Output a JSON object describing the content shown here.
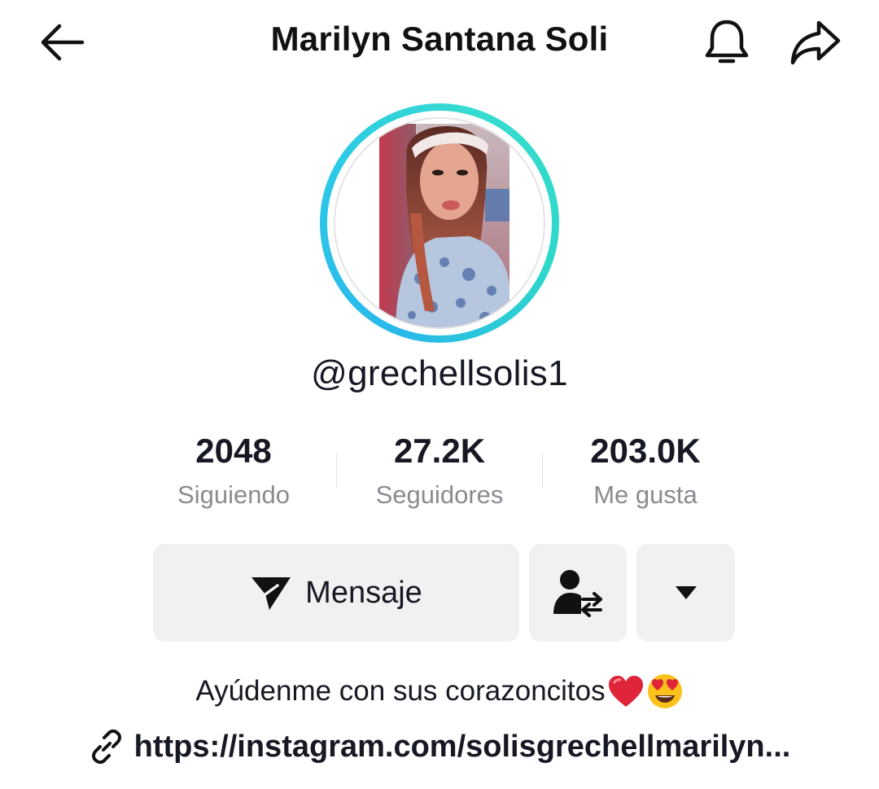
{
  "header": {
    "title": "Marilyn Santana Soli",
    "back_icon": "arrow-left-icon",
    "bell_icon": "bell-icon",
    "share_icon": "share-arrow-icon"
  },
  "profile": {
    "avatar": "profile-photo",
    "ring_colors": [
      "#28b8ea",
      "#36dccf"
    ],
    "username": "@grechellsolis1"
  },
  "stats": [
    {
      "value": "2048",
      "label": "Siguiendo"
    },
    {
      "value": "27.2K",
      "label": "Seguidores"
    },
    {
      "value": "203.0K",
      "label": "Me gusta"
    }
  ],
  "actions": {
    "message_label": "Mensaje",
    "message_icon": "send-icon",
    "follow_icon": "user-swap-icon",
    "more_icon": "caret-down-icon"
  },
  "bio": {
    "text": "Ayúdenme con sus corazoncitos",
    "emojis": [
      "red-heart-icon",
      "heart-eyes-icon"
    ]
  },
  "link": {
    "icon": "link-icon",
    "text": "https://instagram.com/solisgrechellmarilyn..."
  },
  "colors": {
    "text": "#161823",
    "muted": "#8a8b91",
    "button_bg": "#f1f1f2"
  }
}
